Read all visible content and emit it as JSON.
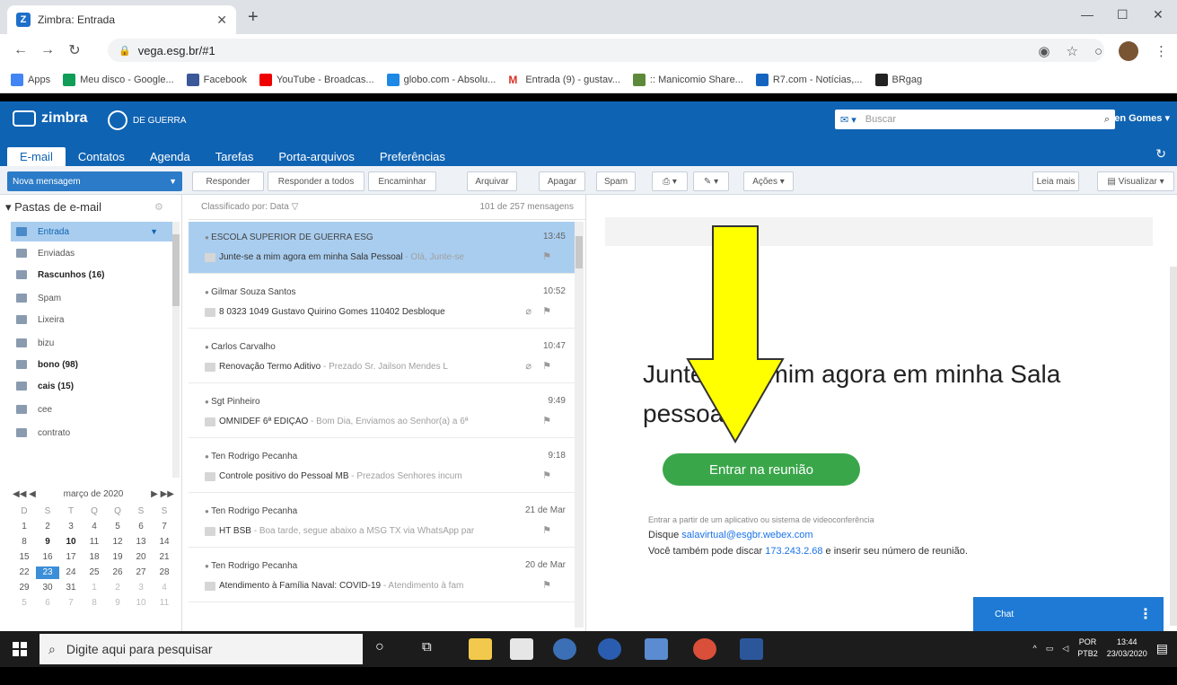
{
  "browser": {
    "tab_title": "Zimbra: Entrada",
    "url": "vega.esg.br/#1",
    "bookmarks": [
      "Apps",
      "Meu disco - Google...",
      "Facebook",
      "YouTube - Broadcas...",
      "globo.com - Absolu...",
      "Entrada (9) - gustav...",
      ":: Manicomio Share...",
      "R7.com - Notícias,...",
      "BRgag"
    ]
  },
  "zimbra": {
    "brand": "zimbra",
    "brand2": "DE GUERRA",
    "search_placeholder": "Buscar",
    "user": "Ten Gomes",
    "tabs": [
      "E-mail",
      "Contatos",
      "Agenda",
      "Tarefas",
      "Porta-arquivos",
      "Preferências"
    ],
    "new_message": "Nova mensagem",
    "toolbar": [
      "Responder",
      "Responder a todos",
      "Encaminhar",
      "Arquivar",
      "Apagar",
      "Spam",
      "Ações"
    ],
    "read_more": "Leia mais",
    "view": "Visualizar"
  },
  "folders": {
    "header": "Pastas de e-mail",
    "items": [
      {
        "label": "Entrada"
      },
      {
        "label": "Enviadas"
      },
      {
        "label": "Rascunhos (16)"
      },
      {
        "label": "Spam"
      },
      {
        "label": "Lixeira"
      },
      {
        "label": "bizu"
      },
      {
        "label": "bono (98)"
      },
      {
        "label": "cais (15)"
      },
      {
        "label": "cee"
      },
      {
        "label": "contrato"
      }
    ]
  },
  "calendar": {
    "month": "março de 2020",
    "weekdays": [
      "D",
      "S",
      "T",
      "Q",
      "Q",
      "S",
      "S"
    ],
    "days": [
      "1",
      "2",
      "3",
      "4",
      "5",
      "6",
      "7",
      "8",
      "9",
      "10",
      "11",
      "12",
      "13",
      "14",
      "15",
      "16",
      "17",
      "18",
      "19",
      "20",
      "21",
      "22",
      "23",
      "24",
      "25",
      "26",
      "27",
      "28",
      "29",
      "30",
      "31",
      "1",
      "2",
      "3",
      "4",
      "5",
      "6",
      "7",
      "8",
      "9",
      "10",
      "11"
    ]
  },
  "list": {
    "sort": "Classificado por: Data",
    "count": "101 de 257 mensagens",
    "messages": [
      {
        "from": "ESCOLA SUPERIOR DE GUERRA ESG",
        "time": "13:45",
        "subject": "Junte-se a mim agora em minha Sala Pessoal",
        "preview": " - Olá, Junte-se"
      },
      {
        "from": "Gilmar Souza Santos",
        "time": "10:52",
        "subject": "8 0323 1049 Gustavo Quirino Gomes 110402 Desbloque",
        "preview": ""
      },
      {
        "from": "Carlos Carvalho",
        "time": "10:47",
        "subject": "Renovação Termo Aditivo",
        "preview": " - Prezado Sr. Jailson Mendes L"
      },
      {
        "from": "Sgt Pinheiro",
        "time": "9:49",
        "subject": "OMNIDEF 6ª EDIÇÃO",
        "preview": " - Bom Dia, Enviamos ao Senhor(a) a 6ª"
      },
      {
        "from": "Ten Rodrigo Pecanha",
        "time": "9:18",
        "subject": "Controle positivo do Pessoal MB",
        "preview": " - Prezados Senhores incum"
      },
      {
        "from": "Ten Rodrigo Pecanha",
        "time": "21 de Mar",
        "subject": "HT BSB",
        "preview": " - Boa tarde, segue abaixo a MSG TX via WhatsApp par"
      },
      {
        "from": "Ten Rodrigo Pecanha",
        "time": "20 de Mar",
        "subject": "Atendimento à Família Naval: COVID-19",
        "preview": " - Atendimento à fam"
      }
    ]
  },
  "reading": {
    "title": "Junte-se a mim agora em minha Sala pessoal.",
    "join_button": "Entrar na reunião",
    "small": "Entrar a partir de um aplicativo ou sistema de videoconferência",
    "dial_label": "Disque ",
    "dial_link": "salavirtual@esgbr.webex.com",
    "also_prefix": "Você também pode discar ",
    "also_ip": "173.243.2.68",
    "also_suffix": " e inserir seu número de reunião.",
    "chat": "Chat"
  },
  "taskbar": {
    "search": "Digite aqui para pesquisar",
    "lang1": "POR",
    "lang2": "PTB2",
    "time": "13:44",
    "date": "23/03/2020"
  },
  "colors": {
    "zimbra_blue": "#0f63b3",
    "join_green": "#3aa64a",
    "arrow_yellow": "#ffff00"
  }
}
